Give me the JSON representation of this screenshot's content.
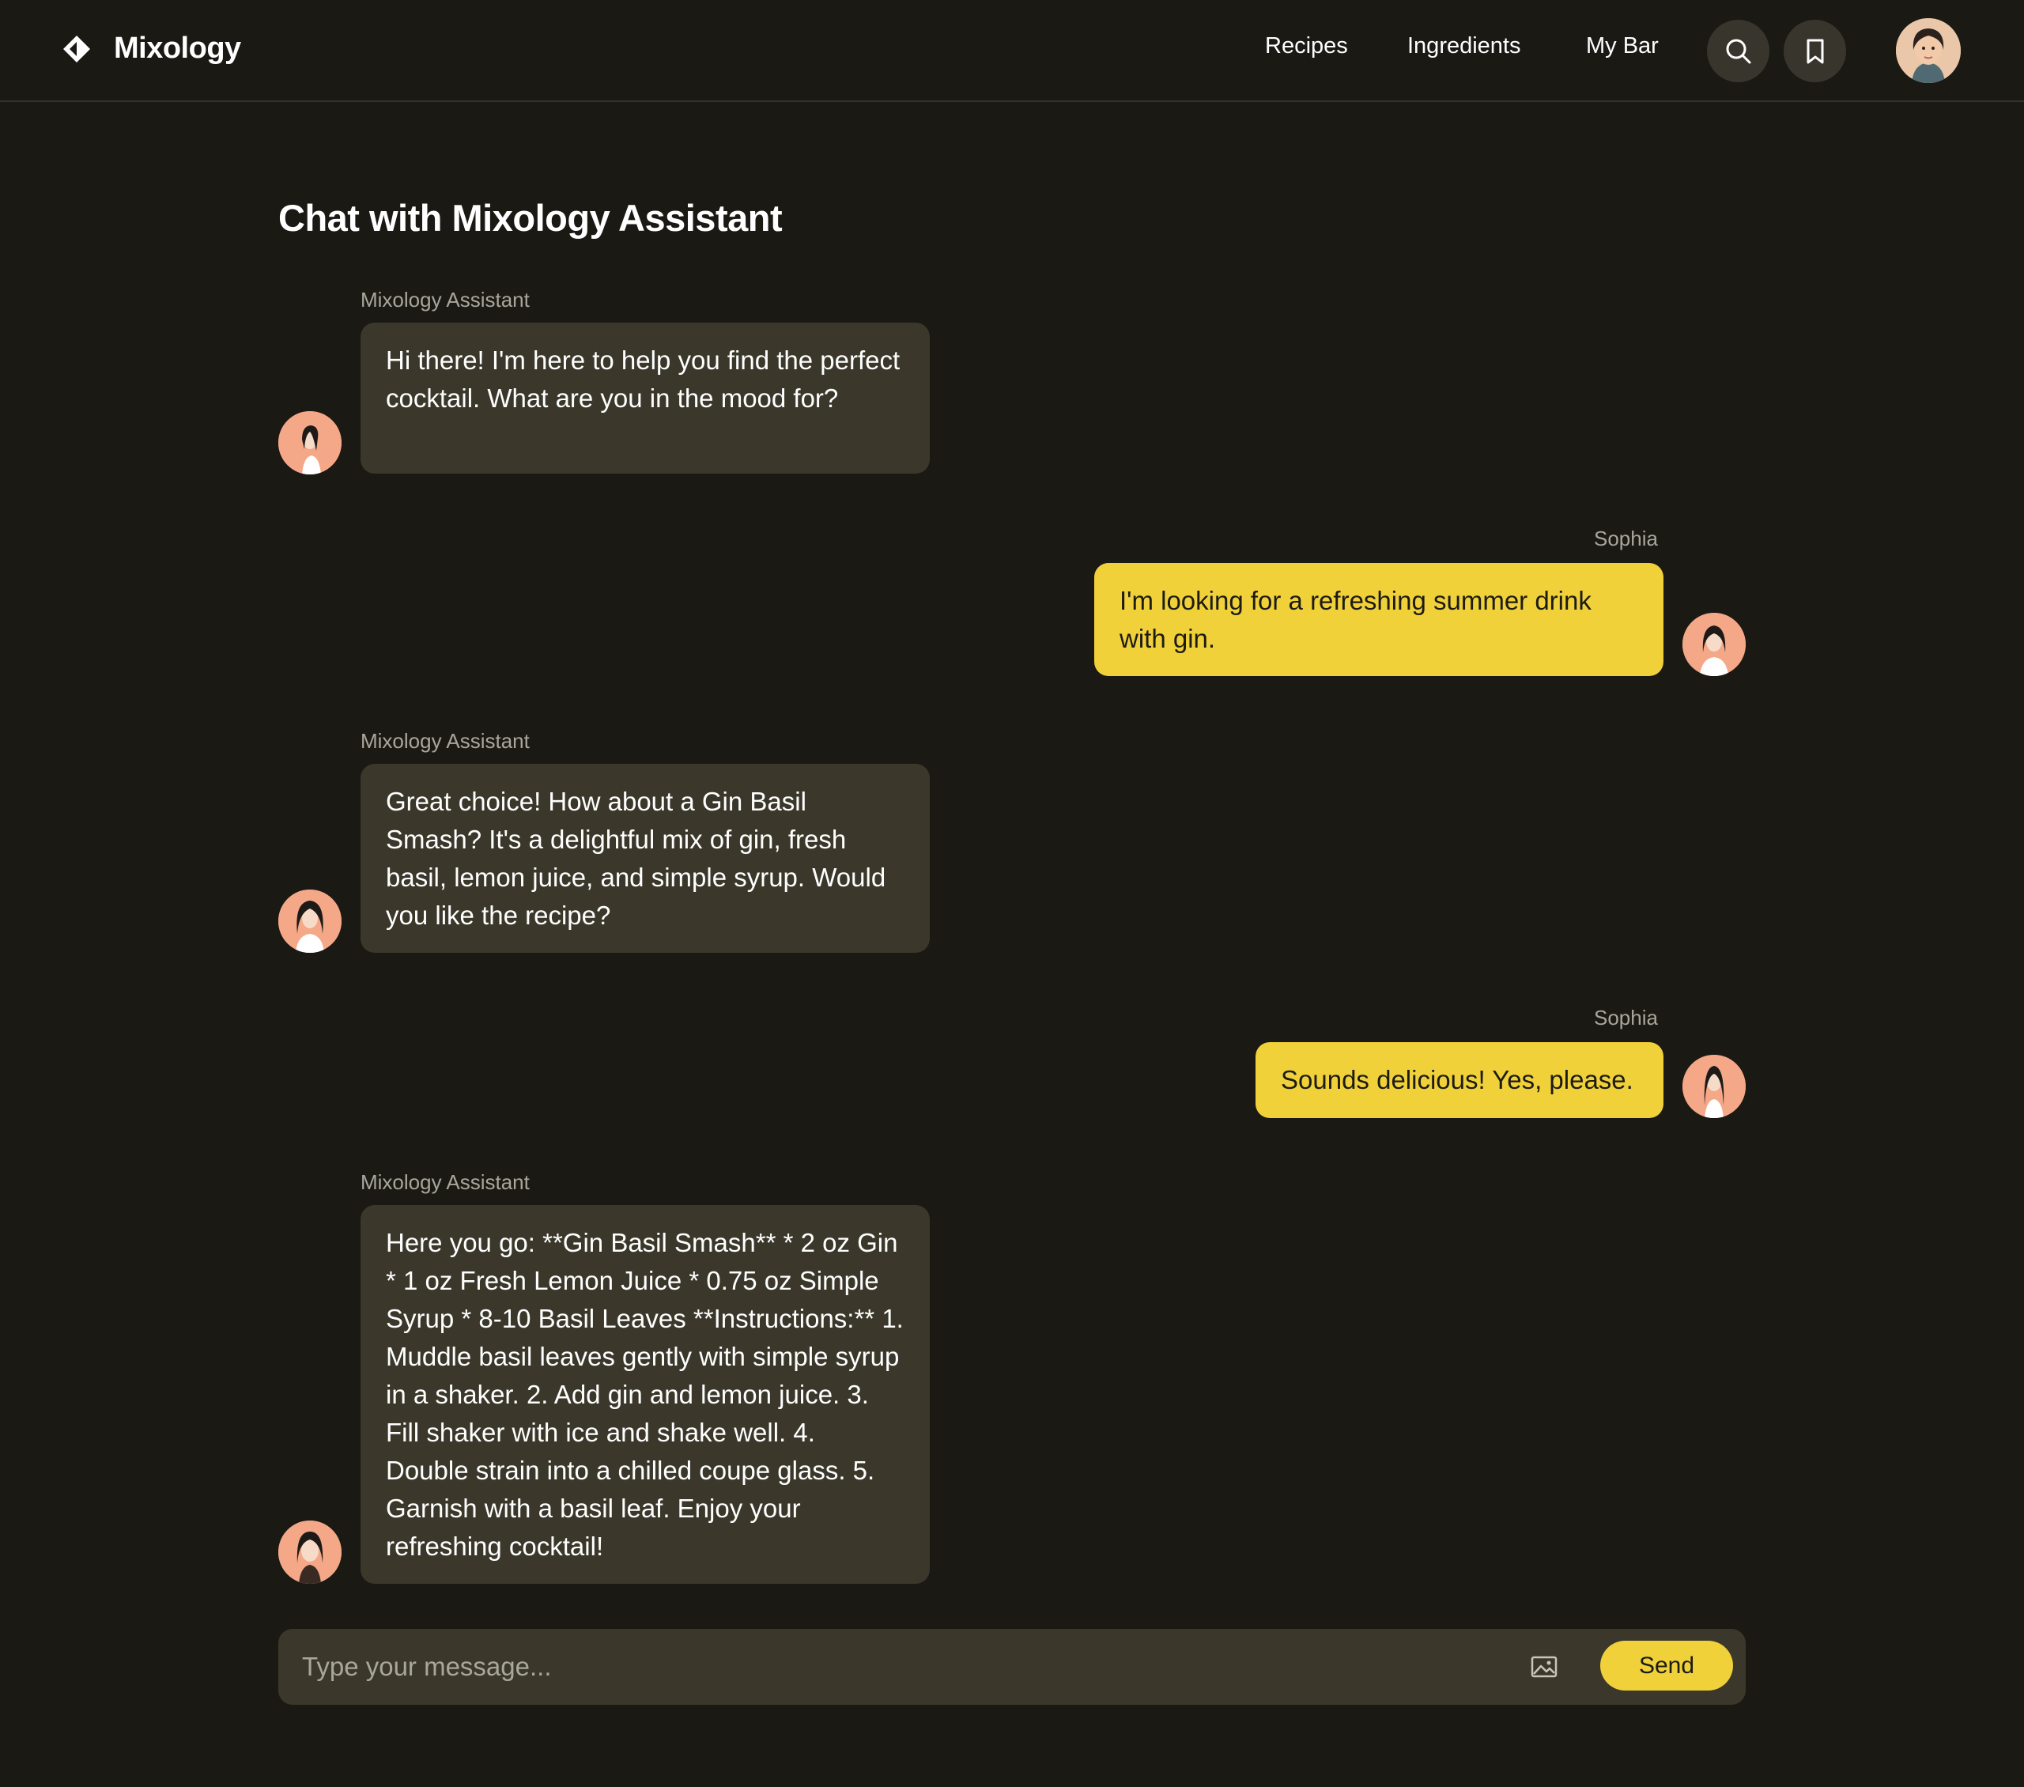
{
  "app": {
    "name": "Mixology",
    "logo_icon": "diamond-logo-icon"
  },
  "nav": {
    "links": [
      "Recipes",
      "Ingredients",
      "My Bar"
    ],
    "search_icon": "search-icon",
    "bookmark_icon": "bookmark-icon",
    "avatar": "user-avatar"
  },
  "page": {
    "title": "Chat with Mixology Assistant"
  },
  "messages": [
    {
      "role": "assistant",
      "sender": "Mixology Assistant",
      "text": "Hi there! I'm here to help you find the perfect cocktail. What are you in the mood for?"
    },
    {
      "role": "user",
      "sender": "Sophia",
      "text": "I'm looking for a refreshing summer drink with gin."
    },
    {
      "role": "assistant",
      "sender": "Mixology Assistant",
      "text": "Great choice! How about a Gin Basil Smash? It's a delightful mix of gin, fresh basil, lemon juice, and simple syrup. Would you like the recipe?"
    },
    {
      "role": "user",
      "sender": "Sophia",
      "text": "Sounds delicious! Yes, please."
    },
    {
      "role": "assistant",
      "sender": "Mixology Assistant",
      "text": "Here you go: **Gin Basil Smash** * 2 oz Gin * 1 oz Fresh Lemon Juice * 0.75 oz Simple Syrup * 8-10 Basil Leaves **Instructions:** 1. Muddle basil leaves gently with simple syrup in a shaker. 2. Add gin and lemon juice. 3. Fill shaker with ice and shake well. 4. Double strain into a chilled coupe glass. 5. Garnish with a basil leaf. Enjoy your refreshing cocktail!"
    }
  ],
  "composer": {
    "placeholder": "Type your message...",
    "value": "",
    "attach_icon": "image-icon",
    "send_label": "Send"
  },
  "colors": {
    "background": "#1a1914",
    "assistant_bubble": "#3b382b",
    "user_bubble": "#f1d13a",
    "accent": "#f1d13a"
  }
}
